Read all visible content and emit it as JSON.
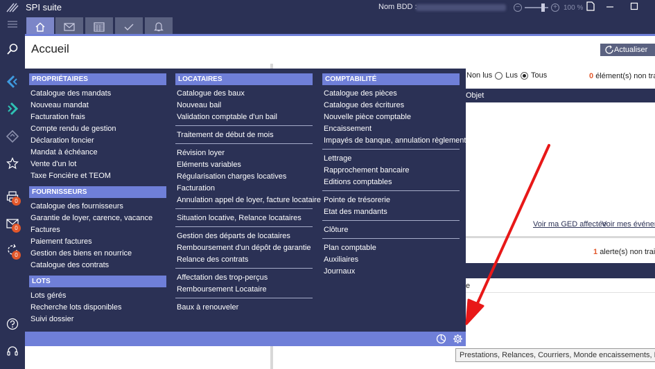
{
  "app": {
    "title": "SPI suite",
    "bdd_label": "Nom BDD :",
    "zoom_minus": "−",
    "zoom_plus": "+",
    "zoom_level": "100 %"
  },
  "page": {
    "title": "Accueil",
    "refresh_label": "Actualiser"
  },
  "sidebar": {
    "badges": [
      "0",
      "0",
      "0"
    ]
  },
  "messages": {
    "filter_non_lus": "Non lus",
    "filter_lus": "Lus",
    "filter_tous": "Tous",
    "selected_filter": "Tous",
    "unprocessed_count": "0",
    "unprocessed_label": "élément(s) non traité",
    "column_objet": "Objet"
  },
  "ged": {
    "link_affectee": "Voir ma GED affectée",
    "link_evenements": "Voir mes événeme"
  },
  "alerts": {
    "count": "1",
    "label": "alerte(s) non traitée",
    "column_partial": "e"
  },
  "menu": {
    "proprietaires": {
      "title": "PROPRIÉTAIRES",
      "items": [
        "Catalogue des mandats",
        "Nouveau mandat",
        "Facturation frais",
        "Compte rendu de gestion",
        "Déclaration foncier",
        "Mandat à échéance",
        "Vente d'un lot",
        "Taxe Foncière et TEOM"
      ]
    },
    "fournisseurs": {
      "title": "FOURNISSEURS",
      "items": [
        "Catalogue des fournisseurs",
        "Garantie de loyer, carence, vacance",
        "Factures",
        "Paiement factures",
        "Gestion des biens en nourrice",
        "Catalogue des contrats"
      ]
    },
    "lots": {
      "title": "LOTS",
      "items": [
        "Lots gérés",
        "Recherche lots disponibles",
        "Suivi dossier"
      ]
    },
    "locataires": {
      "title": "LOCATAIRES",
      "groups": [
        [
          "Catalogue des baux",
          "Nouveau bail",
          "Validation comptable d'un bail"
        ],
        [
          "Traitement de début de mois"
        ],
        [
          "Révision loyer",
          "Eléments variables",
          "Régularisation charges locatives",
          "Facturation",
          "Annulation appel de loyer, facture locataire"
        ],
        [
          "Situation locative, Relance locataires"
        ],
        [
          "Gestion des départs de locataires",
          "Remboursement d'un dépôt de garantie",
          "Relance des contrats"
        ],
        [
          "Affectation des trop-perçus",
          "Remboursement Locataire"
        ],
        [
          "Baux à renouveler"
        ]
      ]
    },
    "comptabilite": {
      "title": "COMPTABILITÉ",
      "groups": [
        [
          "Catalogue des pièces",
          "Catalogue des écritures",
          "Nouvelle pièce comptable",
          "Encaissement",
          "Impayés de banque, annulation règlement"
        ],
        [
          "Lettrage",
          "Rapprochement bancaire",
          "Editions comptables"
        ],
        [
          "Pointe de trésorerie",
          "Etat des mandants"
        ],
        [
          "Clôture"
        ],
        [
          "Plan comptable",
          "Auxiliaires",
          "Journaux"
        ]
      ]
    }
  },
  "tooltip": {
    "text": "Prestations, Relances, Courriers, Monde encaissements, Enumérati"
  },
  "colors": {
    "navy": "#2b3155",
    "accent": "#6f7fd8",
    "badge": "#e2572a",
    "arrow": "#e81818"
  }
}
